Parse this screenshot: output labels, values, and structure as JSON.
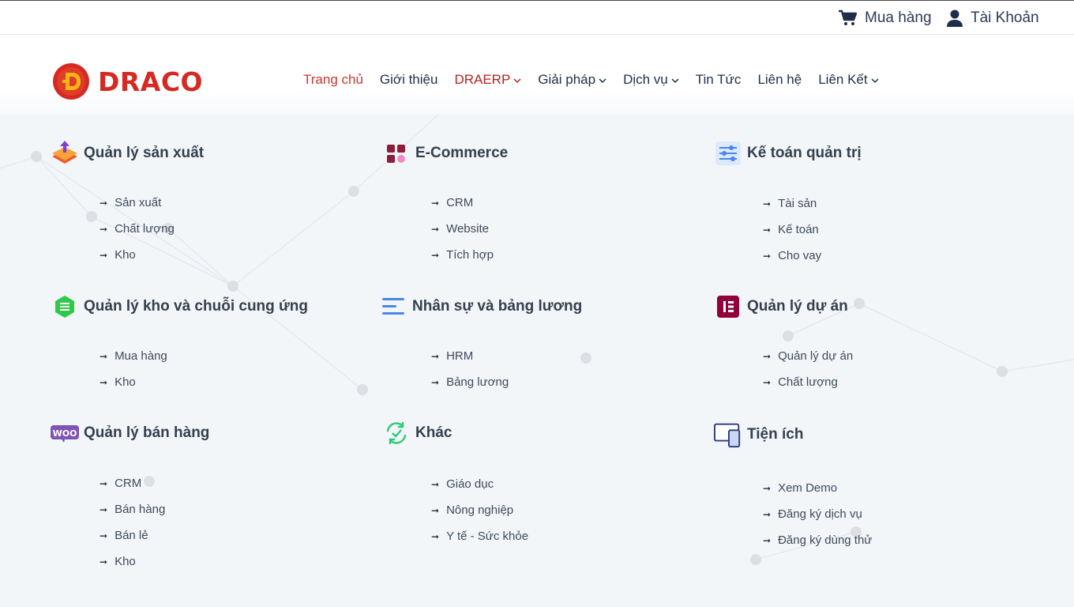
{
  "topbar": {
    "cart_label": "Mua hàng",
    "account_label": "Tài Khoản"
  },
  "brand": {
    "name": "DRACO",
    "color": "#d42a23"
  },
  "nav": {
    "items": [
      {
        "label": "Trang chủ"
      },
      {
        "label": "Giới thiệu"
      },
      {
        "label": "DRAERP"
      },
      {
        "label": "Giải pháp"
      },
      {
        "label": "Dịch vụ"
      },
      {
        "label": "Tin Tức"
      },
      {
        "label": "Liên hệ"
      },
      {
        "label": "Liên Kết"
      }
    ]
  },
  "menu": {
    "sections": [
      {
        "title": "Quản lý sản xuất",
        "icon": "upload-layers-icon",
        "items": [
          "Sản xuất",
          "Chất lượng",
          "Kho"
        ]
      },
      {
        "title": "E-Commerce",
        "icon": "grid-squares-icon",
        "items": [
          "CRM",
          "Website",
          "Tích hợp"
        ]
      },
      {
        "title": "Kế toán quản trị",
        "icon": "sliders-icon",
        "items": [
          "Tài sản",
          "Kế toán",
          "Cho vay"
        ]
      },
      {
        "title": "Quản lý kho và chuỗi cung ứng",
        "icon": "hexagon-list-icon",
        "items": [
          "Mua hàng",
          "Kho"
        ]
      },
      {
        "title": "Nhân sự và bảng lương",
        "icon": "lines-icon",
        "items": [
          "HRM",
          "Bảng lương"
        ]
      },
      {
        "title": "Quản lý dự án",
        "icon": "elementor-icon",
        "items": [
          "Quản lý dự án",
          "Chất lượng"
        ]
      },
      {
        "title": "Quản lý bán hàng",
        "icon": "woo-icon",
        "items": [
          "CRM",
          "Bán hàng",
          "Bán lẻ",
          "Kho"
        ]
      },
      {
        "title": "Khác",
        "icon": "refresh-check-icon",
        "items": [
          "Giáo dục",
          "Nông nghiệp",
          "Y tế - Sức khỏe"
        ]
      },
      {
        "title": "Tiện ích",
        "icon": "devices-icon",
        "items": [
          "Xem Demo",
          "Đăng ký dịch vụ",
          "Đăng ký dùng thử"
        ]
      }
    ]
  }
}
